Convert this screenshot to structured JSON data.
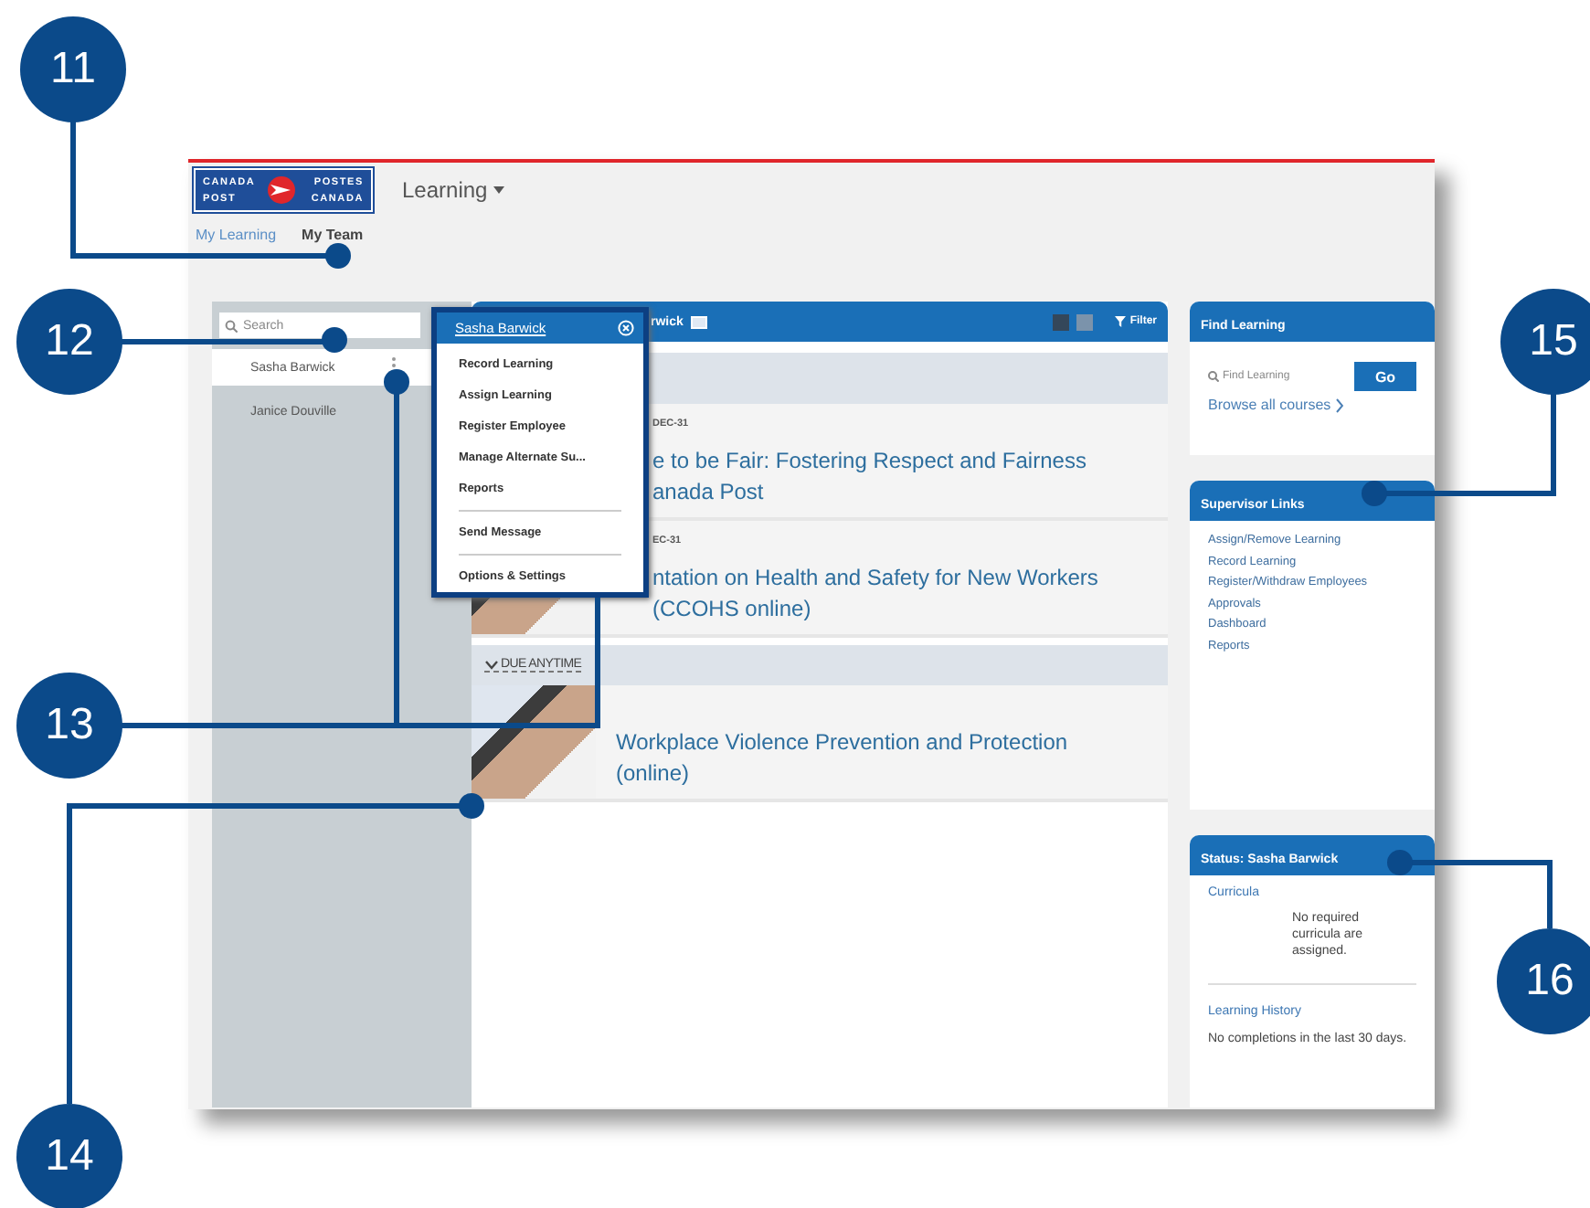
{
  "header": {
    "logo": {
      "top_left": "CANADA",
      "top_right": "POSTES",
      "bottom_left": "POST",
      "bottom_right": "CANADA"
    },
    "menu_label": "Learning"
  },
  "nav_tabs": [
    {
      "label": "My Learning",
      "selected": false
    },
    {
      "label": "My Team",
      "selected": true
    }
  ],
  "team_panel": {
    "search": {
      "placeholder": "Search"
    },
    "members": [
      {
        "name": "Sasha Barwick",
        "selected": true
      },
      {
        "name": "Janice Douville",
        "selected": false
      }
    ]
  },
  "action_menu": {
    "title": "Sasha Barwick",
    "groups": [
      [
        "Record Learning",
        "Assign Learning",
        "Register Employee",
        "Manage Alternate Su...",
        "Reports"
      ],
      [
        "Send Message"
      ],
      [
        "Options & Settings"
      ]
    ]
  },
  "learning": {
    "title": "rwick",
    "filter_label": "Filter",
    "sections": [
      {
        "courses": [
          {
            "due": "DEC-31",
            "title_lines": [
              "e to be Fair: Fostering Respect and Fairness",
              "anada Post"
            ]
          },
          {
            "due": "EC-31",
            "title_lines": [
              "ntation on Health and Safety for New Workers",
              "(CCOHS online)"
            ],
            "image": true
          }
        ]
      },
      {
        "label": "DUE ANYTIME",
        "expanded": true,
        "courses": [
          {
            "title_lines": [
              "Workplace Violence Prevention and Protection",
              "(online)"
            ],
            "image": true
          }
        ]
      }
    ]
  },
  "find_learning": {
    "title": "Find Learning",
    "search": {
      "placeholder": "Find Learning"
    },
    "go": "Go",
    "browse": "Browse all courses"
  },
  "supervisor_links": {
    "title": "Supervisor Links",
    "links": [
      "Assign/Remove Learning",
      "Record Learning",
      "Register/Withdraw Employees",
      "Approvals",
      "Dashboard",
      "Reports"
    ]
  },
  "status": {
    "title": "Status: Sasha Barwick",
    "sections": [
      {
        "heading": "Curricula",
        "text": "No required curricula are assigned."
      },
      {
        "heading": "Learning History",
        "text": "No completions in the last 30 days."
      }
    ]
  },
  "callouts": [
    {
      "number": "11"
    },
    {
      "number": "12"
    },
    {
      "number": "13"
    },
    {
      "number": "14"
    },
    {
      "number": "15"
    },
    {
      "number": "16"
    }
  ]
}
